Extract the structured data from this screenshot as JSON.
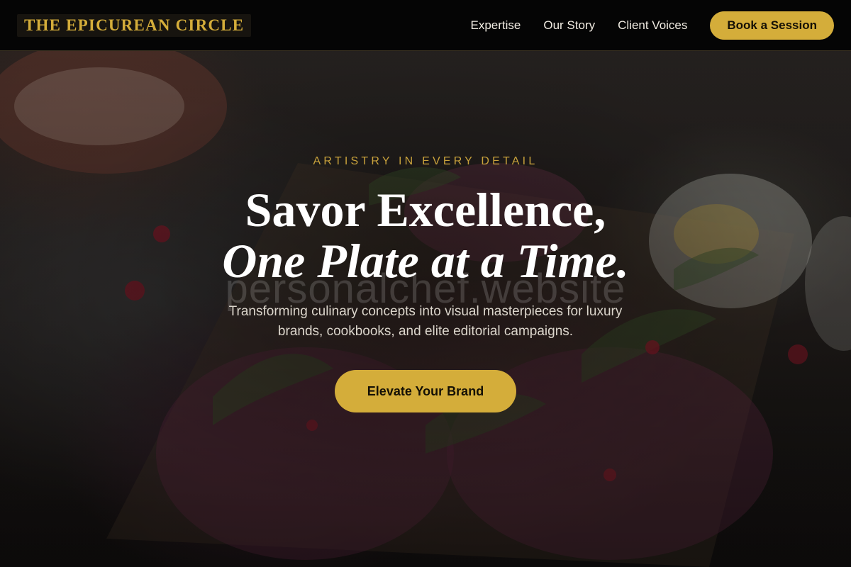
{
  "brand": {
    "name": "THE EPICUREAN CIRCLE"
  },
  "nav": {
    "links": [
      {
        "label": "Expertise"
      },
      {
        "label": "Our Story"
      },
      {
        "label": "Client Voices"
      }
    ],
    "cta_label": "Book a Session"
  },
  "hero": {
    "eyebrow": "ARTISTRY IN EVERY DETAIL",
    "headline_line1": "Savor Excellence,",
    "headline_line2": "One Plate at a Time.",
    "watermark": "personalchef.website",
    "subtitle_line1": "Transforming culinary concepts into visual masterpieces for luxury",
    "subtitle_line2": "brands, cookbooks, and elite editorial campaigns.",
    "cta_label": "Elevate Your Brand",
    "background_image": "food-photo"
  },
  "colors": {
    "accent_gold": "#d4ad3a",
    "header_bg": "#050505",
    "text_light": "#ffffff",
    "subtitle_text": "#dcd6cc"
  }
}
